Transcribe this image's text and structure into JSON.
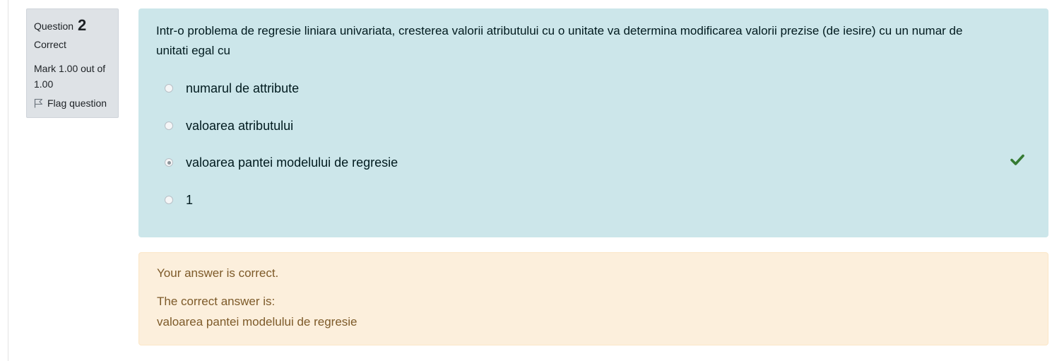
{
  "question": {
    "label": "Question",
    "number": "2",
    "state": "Correct",
    "grade": "Mark 1.00 out of 1.00",
    "flag_label": "Flag question"
  },
  "formulation": {
    "text": "Intr-o problema de regresie liniara univariata, cresterea valorii atributului cu o unitate va determina modificarea valorii prezise (de iesire) cu un numar de unitati egal cu",
    "answers": [
      {
        "label": "numarul de attribute",
        "selected": false
      },
      {
        "label": "valoarea atributului",
        "selected": false
      },
      {
        "label": "valoarea pantei modelului de regresie",
        "selected": true,
        "correct": true
      },
      {
        "label": "1",
        "selected": false
      }
    ]
  },
  "outcome": {
    "feedback": "Your answer is correct.",
    "right_answer_intro": "The correct answer is:",
    "right_answer": "valoarea pantei modelului de regresie"
  },
  "colors": {
    "formulation_bg": "#cce6ea",
    "outcome_bg": "#fcefdc",
    "check": "#357a32"
  },
  "icons": [
    "flag-icon",
    "check-icon"
  ]
}
